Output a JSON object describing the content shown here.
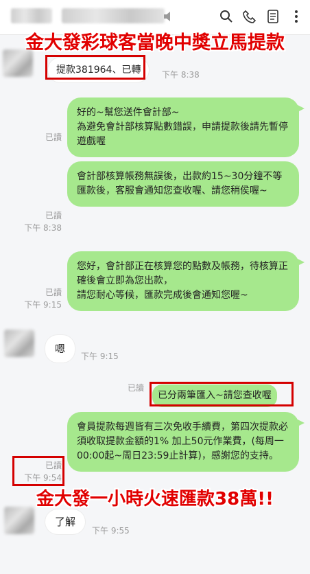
{
  "header": {
    "icons": [
      "speaker-icon",
      "search-icon",
      "phone-icon",
      "notes-icon",
      "more-icon"
    ]
  },
  "banners": {
    "top": "金大發彩球客當晚中獎立馬提款",
    "middle": "金大發一小時火速匯款38萬!!"
  },
  "messages": [
    {
      "id": "m1",
      "side": "in",
      "text": "提款381964、已轉",
      "time": "下午 8:38"
    },
    {
      "id": "m2",
      "side": "out",
      "read": "已讀",
      "time": "",
      "text": "好的~幫您送件會計部~\n為避免會計部核算點數錯誤，申請提款後請先暫停遊戲喔"
    },
    {
      "id": "m3",
      "side": "out",
      "read": "已讀",
      "time": "下午 8:38",
      "text": "會計部核算帳務無誤後，出款約15~30分鐘不等\n匯款後，客服會通知您查收喔、請您稍侯喔~"
    },
    {
      "id": "m4",
      "side": "out",
      "read": "已讀",
      "time": "下午 9:15",
      "text": "您好，會計部正在核算您的點數及帳務，待核算正確後會立即為您出款，\n請您耐心等候，匯款完成後會通知您喔~"
    },
    {
      "id": "m5",
      "side": "in",
      "text": "嗯",
      "time": "下午 9:15"
    },
    {
      "id": "m6",
      "side": "out",
      "read": "已讀",
      "time": "",
      "text": "已分兩筆匯入~請您查收喔"
    },
    {
      "id": "m7",
      "side": "out",
      "read": "已讀",
      "time": "下午 9:54",
      "text": "會員提款每週皆有三次免收手續費，第四次提款必須收取提款金額的1% 加上50元作業費，(每周一00:00起~周日23:59止計算)，感謝您的支持。"
    },
    {
      "id": "m8",
      "side": "in",
      "text": "了解",
      "time": "下午 9:55"
    }
  ],
  "colors": {
    "outgoing_bubble": "#a6e88d",
    "highlight_red": "#d40000",
    "banner_red": "#e10000"
  }
}
